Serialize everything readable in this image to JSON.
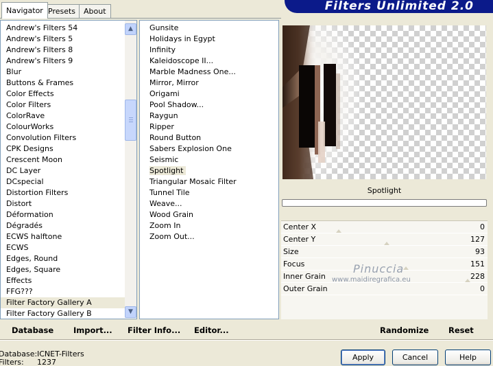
{
  "tabs": [
    {
      "label": "Navigator",
      "active": true
    },
    {
      "label": "Presets",
      "active": false
    },
    {
      "label": "About",
      "active": false
    }
  ],
  "banner": {
    "title": "Filters Unlimited 2.0",
    "color": "#0b1a8a"
  },
  "categories": {
    "items": [
      "Andrew's Filters 54",
      "Andrew's Filters 5",
      "Andrew's Filters 8",
      "Andrew's Filters 9",
      "Blur",
      "Buttons & Frames",
      "Color Effects",
      "Color Filters",
      "ColorRave",
      "ColourWorks",
      "Convolution Filters",
      "CPK Designs",
      "Crescent Moon",
      "DC Layer",
      "DCspecial",
      "Distortion Filters",
      "Distort",
      "Déformation",
      "Dégradés",
      "ECWS halftone",
      "ECWS",
      "Edges, Round",
      "Edges, Square",
      "Effects",
      "FFG???",
      "Filter Factory Gallery A",
      "Filter Factory Gallery B"
    ],
    "selected": "Filter Factory Gallery A"
  },
  "filters": {
    "items": [
      "Gunsite",
      "Holidays in Egypt",
      "Infinity",
      "Kaleidoscope II...",
      "Marble Madness One...",
      "Mirror, Mirror",
      "Origami",
      "Pool Shadow...",
      "Raygun",
      "Ripper",
      "Round Button",
      "Sabers Explosion One",
      "Seismic",
      "Spotlight",
      "Triangular Mosaic Filter",
      "Tunnel Tile",
      "Weave...",
      "Wood Grain",
      "Zoom In",
      "Zoom Out..."
    ],
    "selected": "Spotlight"
  },
  "filter_name": "Spotlight",
  "params": [
    {
      "label": "Center X",
      "value": "0"
    },
    {
      "label": "Center Y",
      "value": "127"
    },
    {
      "label": "Size",
      "value": "93"
    },
    {
      "label": "Focus",
      "value": "151"
    },
    {
      "label": "Inner Grain",
      "value": "228"
    },
    {
      "label": "Outer Grain",
      "value": "0"
    }
  ],
  "watermark": {
    "name": "Pinuccia",
    "site": "www.maidiregrafica.eu"
  },
  "toolbar": {
    "database": "Database",
    "import": "Import...",
    "filter_info": "Filter Info...",
    "editor": "Editor...",
    "randomize": "Randomize",
    "reset": "Reset"
  },
  "status": {
    "database_label": "Database:",
    "database_value": "ICNET-Filters",
    "filters_label": "Filters:",
    "filters_value": "1237"
  },
  "buttons": {
    "apply": "Apply",
    "cancel": "Cancel",
    "help": "Help"
  }
}
